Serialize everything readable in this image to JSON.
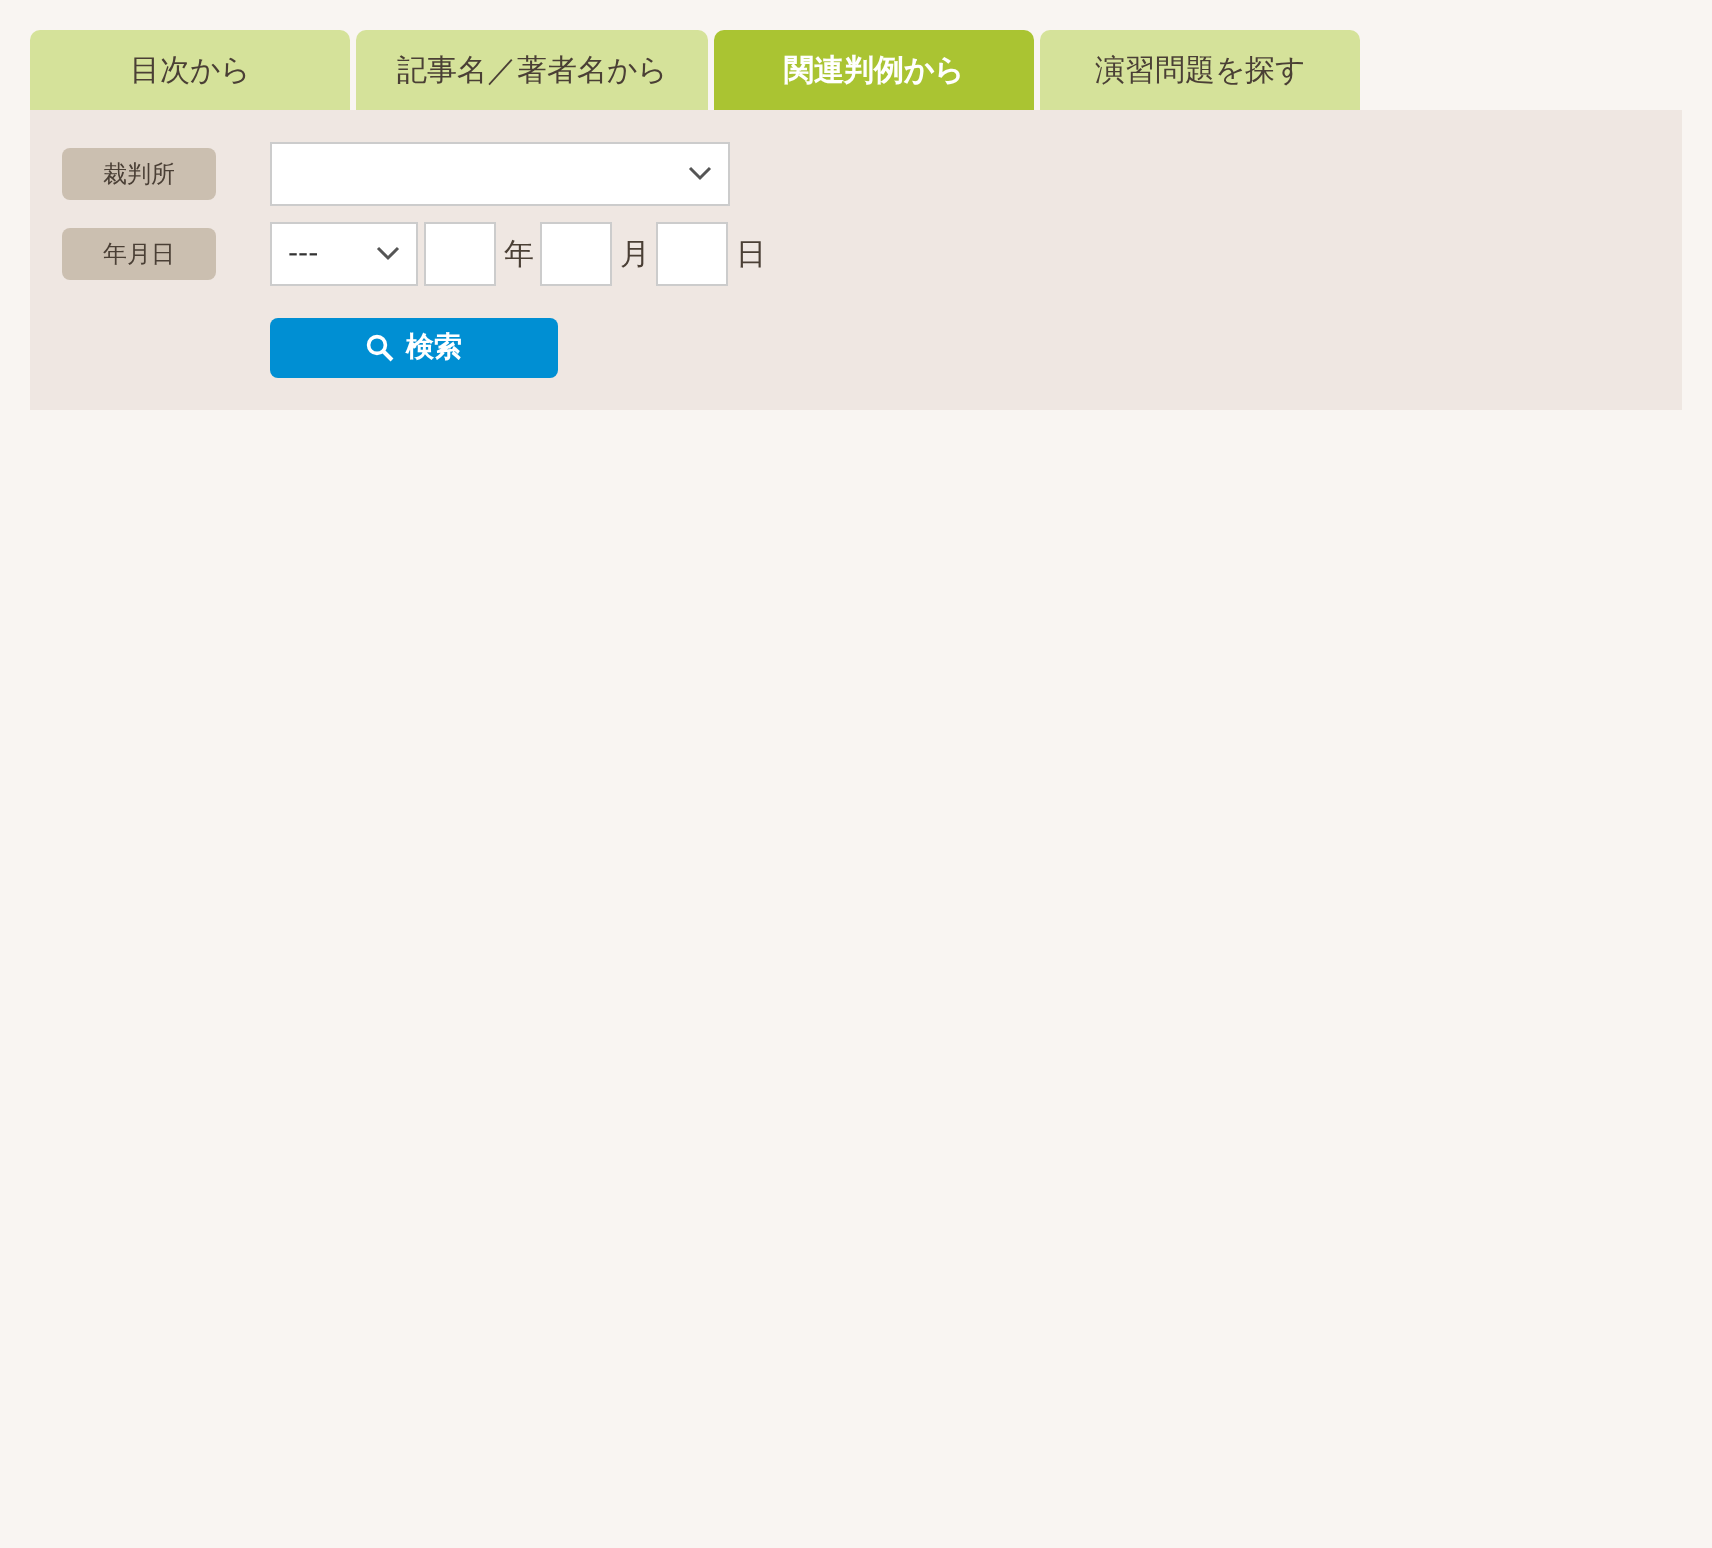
{
  "tabs": [
    {
      "label": "目次から",
      "selected": false
    },
    {
      "label": "記事名／著者名から",
      "selected": false
    },
    {
      "label": "関連判例から",
      "selected": true
    },
    {
      "label": "演習問題を探す",
      "selected": false
    }
  ],
  "form": {
    "court_label": "裁判所",
    "date_label": "年月日",
    "era_value": "---",
    "date_units": [
      "年",
      "月",
      "日"
    ],
    "search_button": "検索"
  }
}
